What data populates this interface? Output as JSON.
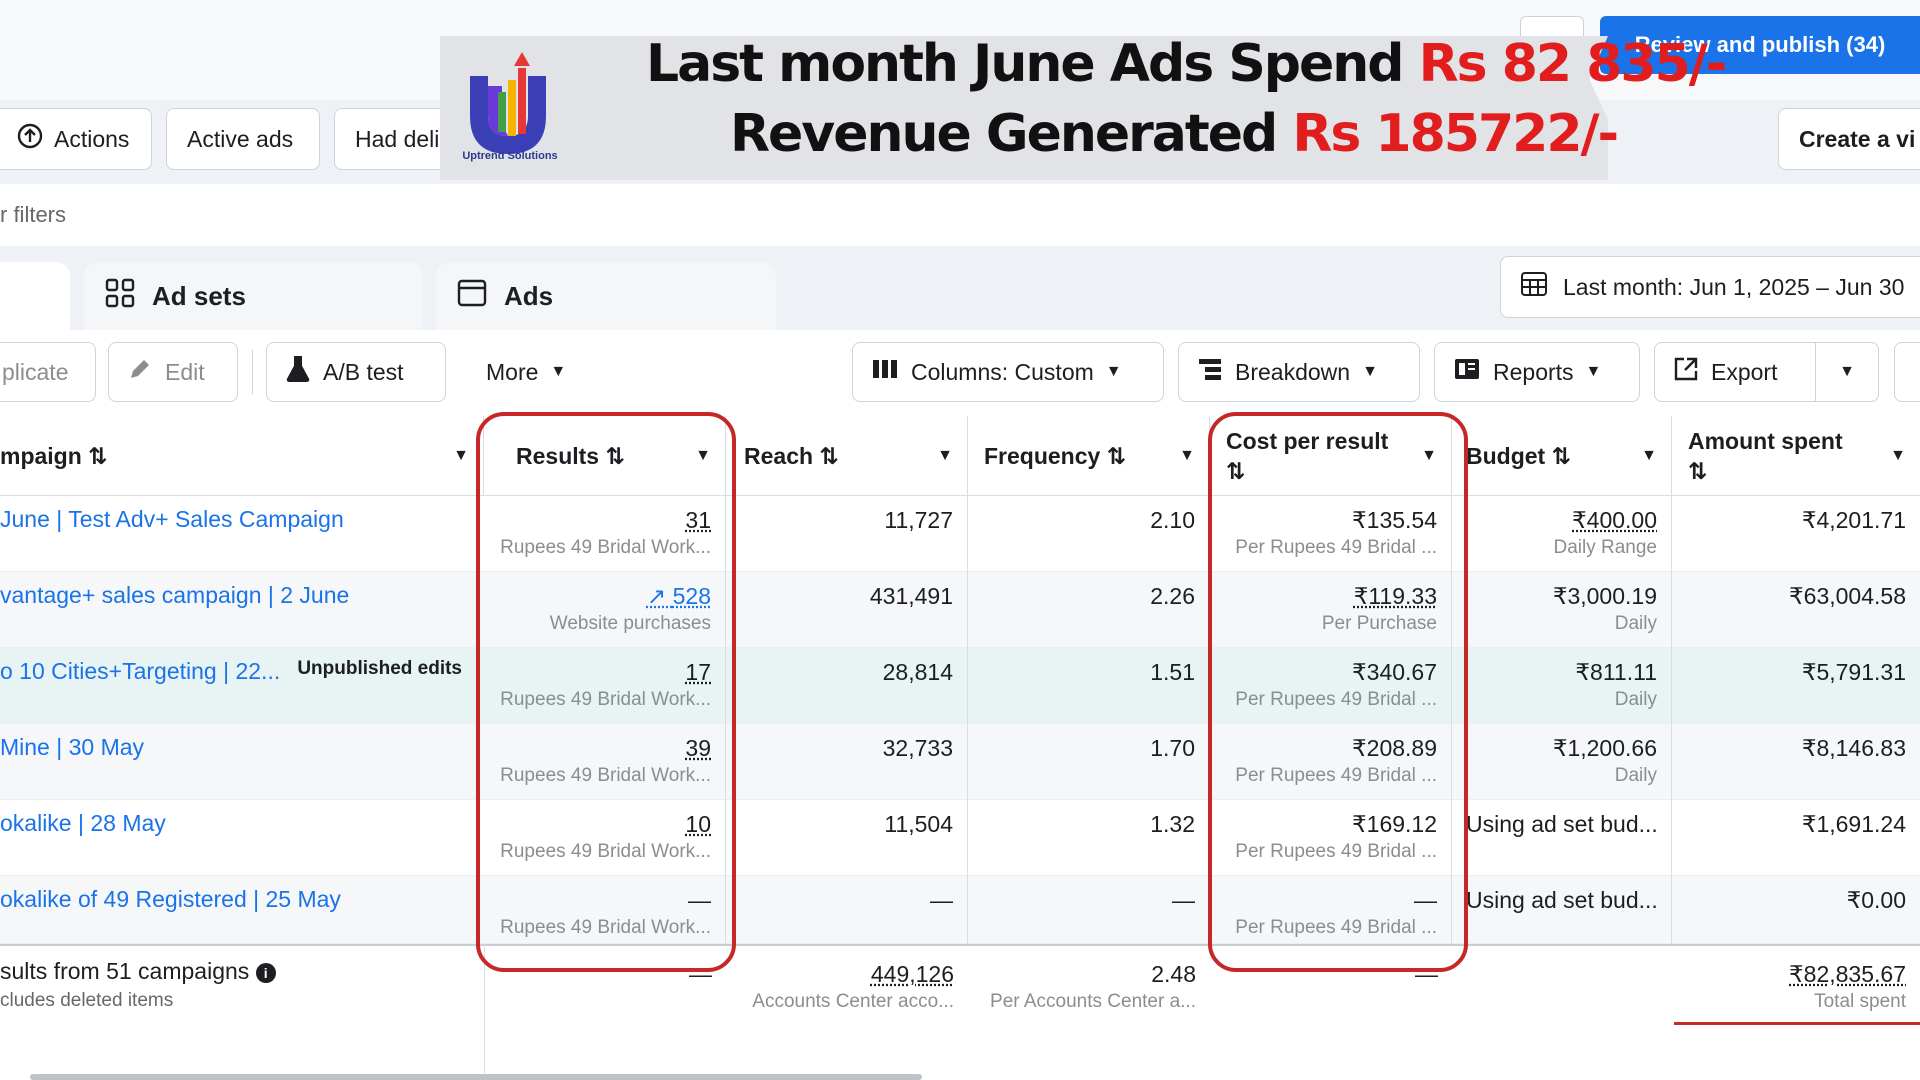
{
  "header": {
    "publish_button": "Review and publish (34)",
    "filters_text": "r filters"
  },
  "filter_chips": {
    "actions": "Actions",
    "active": "Active ads",
    "had": "Had deli",
    "create": "Create a vi"
  },
  "tabs": {
    "adsets": "Ad sets",
    "ads": "Ads"
  },
  "date_range": "Last month: Jun 1, 2025 – Jun 30",
  "toolbar": {
    "duplicate": "plicate",
    "edit": "Edit",
    "ab_test": "A/B test",
    "more": "More",
    "columns": "Columns: Custom",
    "breakdown": "Breakdown",
    "reports": "Reports",
    "export": "Export"
  },
  "banner": {
    "line1_prefix": "Last month June Ads Spend ",
    "line1_value": "Rs 82 835/-",
    "line2_prefix": "Revenue Generated ",
    "line2_value": "Rs 185722/-",
    "logo_text": "Uptrend Solutions",
    "colors": {
      "accent": "#e11d1d",
      "brand_blue": "#2b3a8f",
      "link_blue": "#1a73e8",
      "highlight": "#c62828"
    }
  },
  "columns": {
    "campaign": "mpaign ⇅",
    "results": "Results ⇅",
    "reach": "Reach ⇅",
    "frequency": "Frequency ⇅",
    "cpr_1": "Cost per result",
    "cpr_2": "⇅",
    "budget": "Budget ⇅",
    "spent_1": "Amount spent",
    "spent_2": "⇅"
  },
  "rows": [
    {
      "name": "June | Test Adv+ Sales Campaign",
      "badge": "",
      "results": "31",
      "results_sub": "Rupees 49 Bridal Work...",
      "reach": "11,727",
      "frequency": "2.10",
      "cpr": "₹135.54",
      "cpr_sub": "Per Rupees 49 Bridal ...",
      "budget": "₹400.00",
      "budget_sub": "Daily Range",
      "spent": "₹4,201.71"
    },
    {
      "name": "vantage+ sales campaign | 2 June",
      "badge": "",
      "results": "528",
      "results_sub": "Website purchases",
      "reach": "431,491",
      "frequency": "2.26",
      "cpr": "₹119.33",
      "cpr_sub": "Per Purchase",
      "budget": "₹3,000.19",
      "budget_sub": "Daily",
      "spent": "₹63,004.58"
    },
    {
      "name": "o 10 Cities+Targeting | 22...",
      "badge": "Unpublished edits",
      "results": "17",
      "results_sub": "Rupees 49 Bridal Work...",
      "reach": "28,814",
      "frequency": "1.51",
      "cpr": "₹340.67",
      "cpr_sub": "Per Rupees 49 Bridal ...",
      "budget": "₹811.11",
      "budget_sub": "Daily",
      "spent": "₹5,791.31"
    },
    {
      "name": "Mine | 30 May",
      "badge": "",
      "results": "39",
      "results_sub": "Rupees 49 Bridal Work...",
      "reach": "32,733",
      "frequency": "1.70",
      "cpr": "₹208.89",
      "cpr_sub": "Per Rupees 49 Bridal ...",
      "budget": "₹1,200.66",
      "budget_sub": "Daily",
      "spent": "₹8,146.83"
    },
    {
      "name": "okalike | 28 May",
      "badge": "",
      "results": "10",
      "results_sub": "Rupees 49 Bridal Work...",
      "reach": "11,504",
      "frequency": "1.32",
      "cpr": "₹169.12",
      "cpr_sub": "Per Rupees 49 Bridal ...",
      "budget": "Using ad set bud...",
      "budget_sub": "",
      "spent": "₹1,691.24"
    },
    {
      "name": "okalike of 49 Registered | 25 May",
      "badge": "",
      "results": "—",
      "results_sub": "Rupees 49 Bridal Work...",
      "reach": "—",
      "frequency": "—",
      "cpr": "—",
      "cpr_sub": "Per Rupees 49 Bridal ...",
      "budget": "Using ad set bud...",
      "budget_sub": "",
      "spent": "₹0.00"
    }
  ],
  "footer": {
    "label": "sults from 51 campaigns",
    "sub": "cludes deleted items",
    "results": "—",
    "reach": "449,126",
    "reach_sub": "Accounts Center acco...",
    "frequency": "2.48",
    "frequency_sub": "Per Accounts Center a...",
    "cpr": "—",
    "spent": "₹82,835.67",
    "spent_sub": "Total spent"
  }
}
